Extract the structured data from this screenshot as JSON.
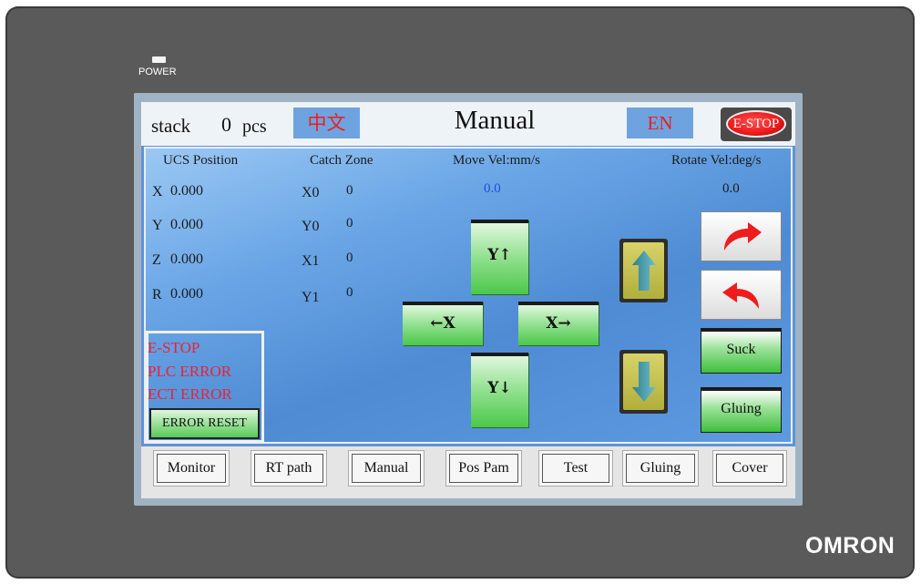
{
  "device": {
    "power_label": "POWER",
    "brand": "OMRON"
  },
  "header": {
    "stack_label": "stack",
    "stack_count": "0",
    "stack_unit": "pcs",
    "lang_cn": "中文",
    "title": "Manual",
    "lang_en": "EN",
    "estop": "E-STOP"
  },
  "columns": {
    "ucs": "UCS Position",
    "catch": "Catch Zone",
    "move_vel": "Move Vel:mm/s",
    "rotate_vel": "Rotate Vel:deg/s"
  },
  "ucs": [
    {
      "axis": "X",
      "value": "0.000"
    },
    {
      "axis": "Y",
      "value": "0.000"
    },
    {
      "axis": "Z",
      "value": "0.000"
    },
    {
      "axis": "R",
      "value": "0.000"
    }
  ],
  "catch_zone": [
    {
      "name": "X0",
      "value": "0"
    },
    {
      "name": "Y0",
      "value": "0"
    },
    {
      "name": "X1",
      "value": "0"
    },
    {
      "name": "Y1",
      "value": "0"
    }
  ],
  "move_vel": "0.0",
  "rotate_vel": "0.0",
  "jog": {
    "y_up": "Y↑",
    "y_down": "Y↓",
    "x_left": "←X",
    "x_right": "X→"
  },
  "buttons": {
    "suck": "Suck",
    "gluing": "Gluing",
    "error_reset": "ERROR RESET"
  },
  "errors": {
    "estop": "E-STOP",
    "plc": "PLC ERROR",
    "ect": "ECT ERROR"
  },
  "tabs": [
    "Monitor",
    "RT path",
    "Manual",
    "Pos Pam",
    "Test",
    "Gluing",
    "Cover"
  ],
  "colors": {
    "screen_bg": "#5f94d6",
    "error_text": "#e8233a",
    "button_green": "#3fbf3d",
    "estop_red": "#ee1c1c",
    "velocity_text": "#1f4fd8"
  }
}
